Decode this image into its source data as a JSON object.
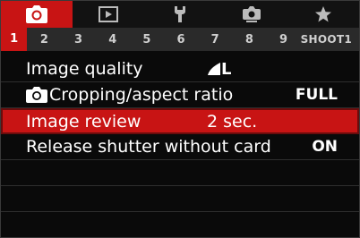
{
  "category_tabs": [
    {
      "icon": "camera-icon",
      "active": true
    },
    {
      "icon": "playback-icon",
      "active": false
    },
    {
      "icon": "wrench-icon",
      "active": false
    },
    {
      "icon": "custom-functions-icon",
      "active": false
    },
    {
      "icon": "star-icon",
      "active": false
    }
  ],
  "pages": [
    "1",
    "2",
    "3",
    "4",
    "5",
    "6",
    "7",
    "8",
    "9"
  ],
  "page_label": "SHOOT1",
  "menu": {
    "items": [
      {
        "label": "Image quality",
        "value": "L",
        "value_icon": "quality-large-fine-icon"
      },
      {
        "label": "Cropping/aspect ratio",
        "label_icon": "camera-small-icon",
        "value": "FULL"
      },
      {
        "label": "Image review",
        "value": "2 sec."
      },
      {
        "label": "Release shutter without card",
        "value": "ON"
      }
    ]
  },
  "colors": {
    "accent": "#c81414",
    "background": "#0a0a0a",
    "page_bar": "#2a2a2a"
  }
}
